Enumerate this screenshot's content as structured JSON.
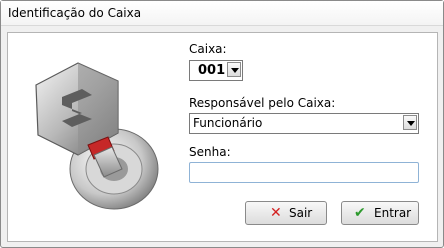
{
  "window": {
    "title": "Identificação do Caixa"
  },
  "form": {
    "caixa_label": "Caixa:",
    "caixa_value": "001",
    "responsavel_label": "Responsável pelo Caixa:",
    "responsavel_value": "Funcionário",
    "senha_label": "Senha:",
    "senha_value": ""
  },
  "buttons": {
    "sair_label": "Sair",
    "entrar_label": "Entrar"
  },
  "icons": {
    "illustration": "key-in-lock-icon",
    "sair": "x-icon",
    "entrar": "checkmark-icon"
  },
  "colors": {
    "sair_icon": "#d32020",
    "entrar_icon": "#2e9a2e",
    "input_border": "#8fb3d6"
  }
}
